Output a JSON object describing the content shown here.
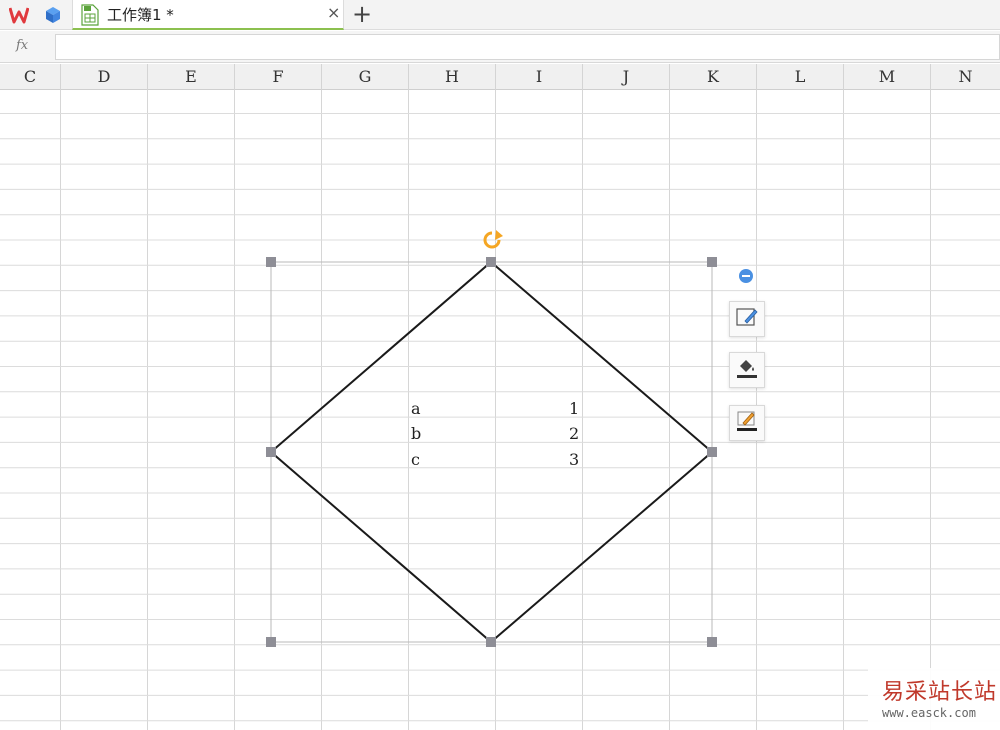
{
  "tabbar": {
    "wps_logo_icon": "wps-logo-icon",
    "app_icon": "cube-icon",
    "doc_tab": {
      "title": "工作簿1 *",
      "icon": "spreadsheet-file-icon",
      "close_label": "×"
    },
    "new_tab_label": "+"
  },
  "formula_bar": {
    "fx_label": "fx",
    "value": ""
  },
  "columns": [
    "C",
    "D",
    "E",
    "F",
    "G",
    "H",
    "I",
    "J",
    "K",
    "L",
    "M",
    "N"
  ],
  "cells": [
    {
      "label": "a",
      "value": "1"
    },
    {
      "label": "b",
      "value": "2"
    },
    {
      "label": "c",
      "value": "3"
    }
  ],
  "shape": {
    "type": "diamond",
    "rotate_icon": "rotate-handle-icon",
    "accent_color": "#f5a623"
  },
  "shape_toolbar": {
    "collapse_icon": "minus-circle-icon",
    "buttons": [
      {
        "icon": "edit-shape-icon"
      },
      {
        "icon": "fill-bucket-icon"
      },
      {
        "icon": "outline-pen-icon"
      }
    ]
  },
  "watermark": {
    "title": "易采站长站",
    "url": "www.easck.com"
  }
}
